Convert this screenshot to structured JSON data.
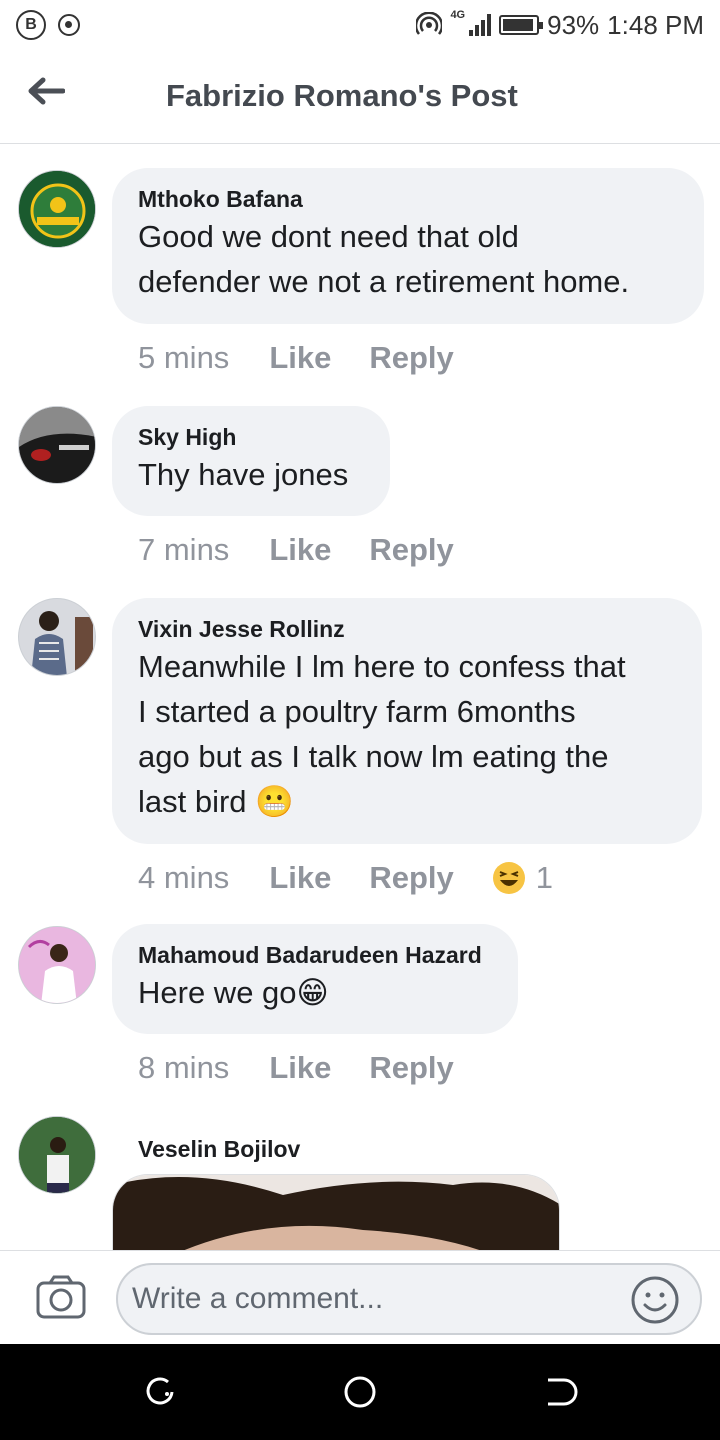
{
  "status_bar": {
    "network": "4G",
    "battery": "93%",
    "time": "1:48 PM"
  },
  "header": {
    "title": "Fabrizio Romano's Post"
  },
  "comments": [
    {
      "author": "Mthoko Bafana",
      "text": [
        "Good we dont need that old",
        "defender we not a retirement home."
      ],
      "time": "5 mins",
      "like": "Like",
      "reply": "Reply"
    },
    {
      "author": "Sky High",
      "text": [
        "Thy have jones"
      ],
      "time": "7 mins",
      "like": "Like",
      "reply": "Reply"
    },
    {
      "author": "Vixin Jesse Rollinz",
      "text": [
        "Meanwhile I lm here to confess that",
        "I started a poultry farm 6months",
        "ago but as I talk now lm eating the",
        "last bird 😬"
      ],
      "time": "4 mins",
      "like": "Like",
      "reply": "Reply",
      "reaction_count": "1"
    },
    {
      "author": "Mahamoud Badarudeen Hazard",
      "text": [
        "Here we go😁"
      ],
      "time": "8 mins",
      "like": "Like",
      "reply": "Reply"
    },
    {
      "author": "Veselin Bojilov"
    }
  ],
  "composer": {
    "placeholder": "Write a comment..."
  },
  "icons": {
    "back": "back-arrow-icon",
    "camera": "camera-icon",
    "emoji": "smiley-icon"
  }
}
